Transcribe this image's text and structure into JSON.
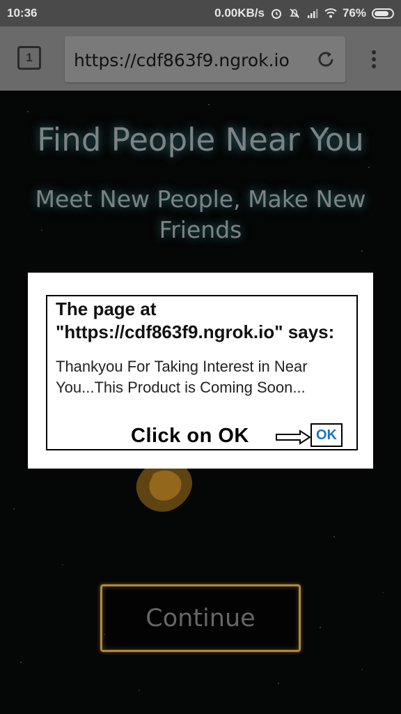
{
  "status_bar": {
    "time": "10:36",
    "network_speed": "0.00KB/s",
    "battery": "76%",
    "icons": [
      "alarm-icon",
      "mute-icon",
      "signal-icon",
      "wifi-icon",
      "battery-icon"
    ]
  },
  "browser": {
    "tab_count": "1",
    "url": "https://cdf863f9.ngrok.io"
  },
  "page": {
    "title": "Find People Near You",
    "subtitle": "Meet New People, Make New Friends",
    "continue_label": "Continue"
  },
  "dialog": {
    "title": "The page at \"https://cdf863f9.ngrok.io\" says:",
    "message": "Thankyou For Taking Interest in Near You...This Product is Coming Soon...",
    "hint": "Click on OK",
    "ok_label": "OK"
  },
  "colors": {
    "status_bar": "#4a4a4a",
    "toolbar": "#6a6a6a",
    "heading_glow": "#50bec8",
    "button_border": "#b18a3a",
    "ok_text": "#1a73c9"
  }
}
